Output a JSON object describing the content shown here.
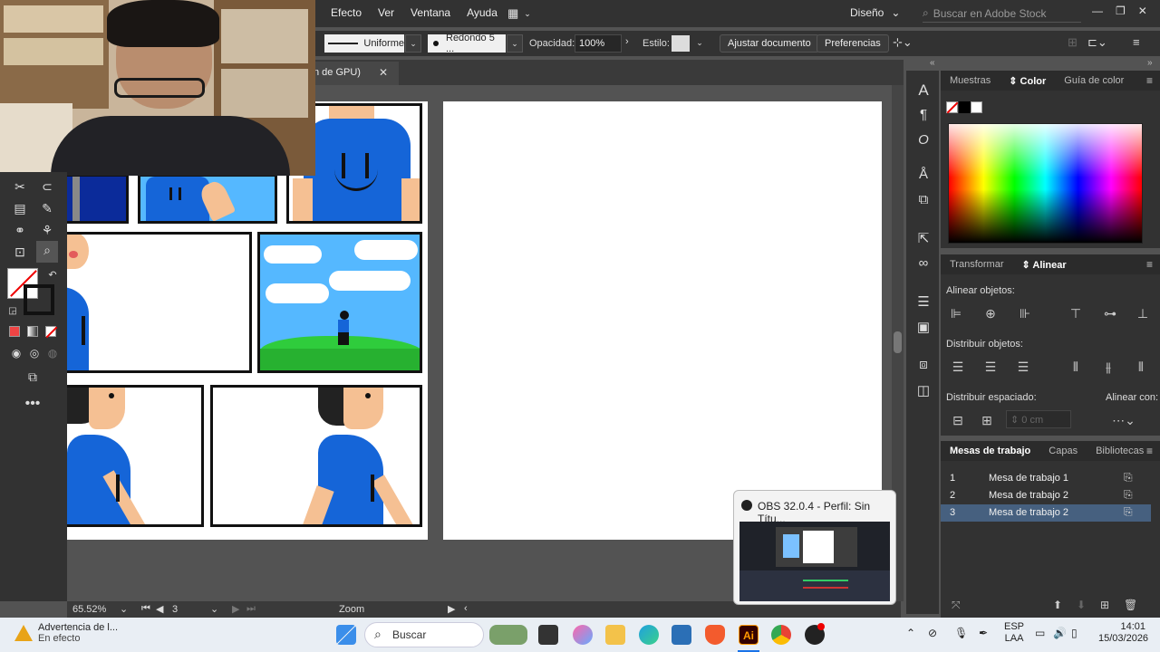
{
  "menu": {
    "items": [
      "Efecto",
      "Ver",
      "Ventana",
      "Ayuda"
    ],
    "workspace": "Diseño",
    "stock_search_placeholder": "Buscar en Adobe Stock"
  },
  "control_bar": {
    "stroke_profile": "Uniforme",
    "brush": "Redondo 5 ...",
    "opacity_label": "Opacidad:",
    "opacity_value": "100%",
    "style_label": "Estilo:",
    "adjust_document": "Ajustar documento",
    "preferences": "Preferencias"
  },
  "document_tab": {
    "title": "n de GPU)",
    "close": "✕"
  },
  "right_panels": {
    "color_tabs": [
      "Muestras",
      "Color",
      "Guía de color"
    ],
    "color_active": "Color",
    "align_tabs": [
      "Transformar",
      "Alinear"
    ],
    "align_active": "Alinear",
    "align_objects": "Alinear objetos:",
    "distribute_objects": "Distribuir objetos:",
    "distribute_spacing": "Distribuir espaciado:",
    "align_to": "Alinear con:",
    "spacing_value": "0 cm",
    "artboard_tabs": [
      "Mesas de trabajo",
      "Capas",
      "Bibliotecas"
    ],
    "artboard_active": "Mesas de trabajo",
    "artboards": [
      {
        "num": "1",
        "name": "Mesa de trabajo 1",
        "selected": false
      },
      {
        "num": "2",
        "name": "Mesa de trabajo 2",
        "selected": false
      },
      {
        "num": "3",
        "name": "Mesa de trabajo 2",
        "selected": true
      }
    ]
  },
  "status_bar": {
    "zoom": "65.52%",
    "artboard": "3",
    "tool": "Zoom"
  },
  "obs_popup": {
    "title": "OBS 32.0.4 - Perfil: Sin Títu..."
  },
  "taskbar": {
    "weather_title": "Advertencia de l...",
    "weather_sub": "En efecto",
    "search_placeholder": "Buscar",
    "lang1": "ESP",
    "lang2": "LAA",
    "time": "14:01",
    "date": "15/03/2026"
  },
  "colors": {
    "accent_selection": "#46607f",
    "shirt_blue": "#1565d8",
    "sky_blue": "#55b8ff",
    "grass_green": "#2fcc3c",
    "skin": "#f5c093"
  }
}
